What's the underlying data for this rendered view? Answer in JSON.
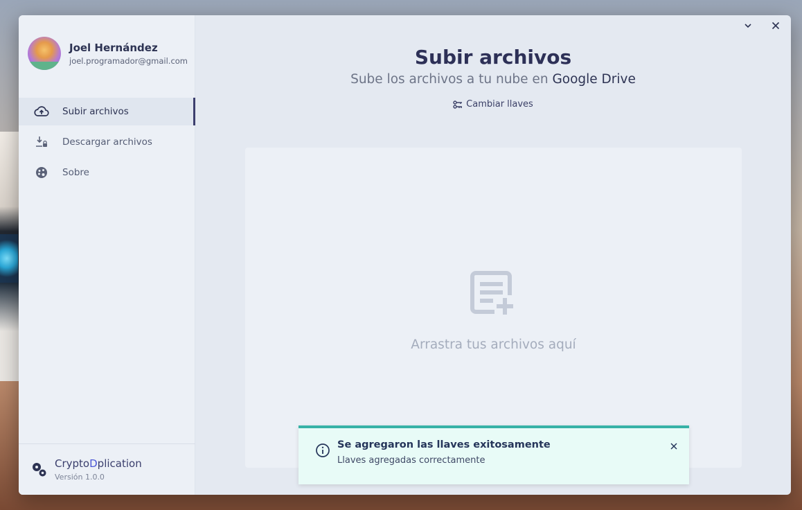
{
  "user": {
    "name": "Joel Hernández",
    "email": "joel.programador@gmail.com"
  },
  "nav": {
    "items": [
      {
        "label": "Subir archivos",
        "icon": "cloud-upload-icon",
        "active": true
      },
      {
        "label": "Descargar archivos",
        "icon": "download-lock-icon",
        "active": false
      },
      {
        "label": "Sobre",
        "icon": "palette-icon",
        "active": false
      }
    ]
  },
  "app": {
    "name_part1": "Crypto",
    "name_part2": "D",
    "name_part3": "plication",
    "version": "Versión 1.0.0"
  },
  "main": {
    "title": "Subir archivos",
    "subtitle_prefix": "Sube los archivos a tu nube en ",
    "subtitle_brand": "Google Drive",
    "change_keys_label": "Cambiar llaves",
    "dropzone_text": "Arrastra tus archivos aquí"
  },
  "toast": {
    "title": "Se agregaron las llaves exitosamente",
    "message": "Llaves agregadas correctamente"
  },
  "colors": {
    "accent": "#3d3f6e",
    "toast_border": "#38b2a7",
    "toast_bg": "#e8fbf7",
    "logo_accent": "#4b57d6"
  }
}
